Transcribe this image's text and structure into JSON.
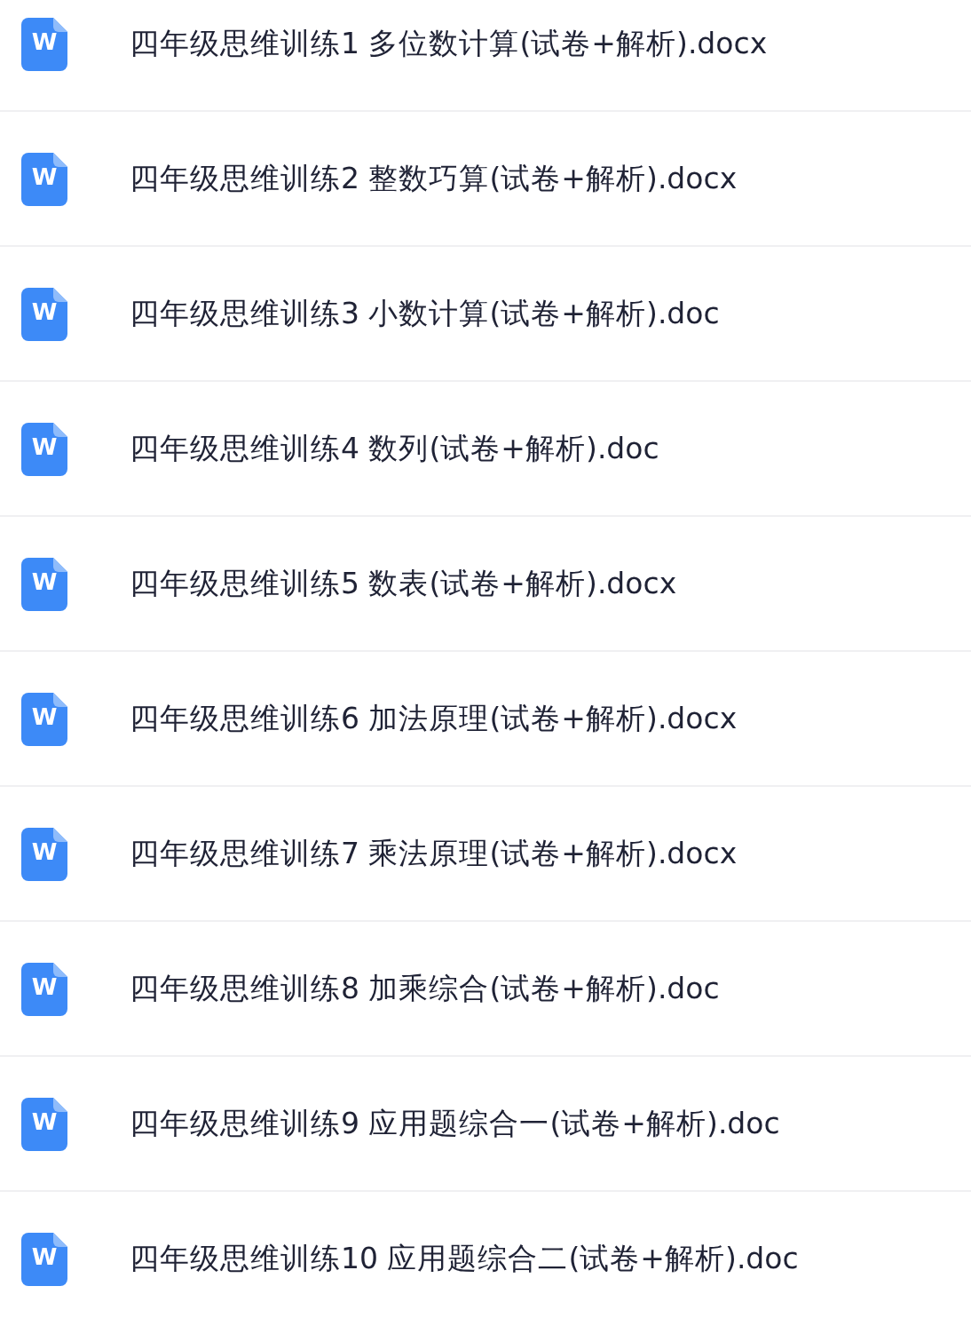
{
  "files": [
    {
      "icon_letter": "W",
      "name": "四年级思维训练1 多位数计算(试卷+解析).docx"
    },
    {
      "icon_letter": "W",
      "name": "四年级思维训练2 整数巧算(试卷+解析).docx"
    },
    {
      "icon_letter": "W",
      "name": "四年级思维训练3 小数计算(试卷+解析).doc"
    },
    {
      "icon_letter": "W",
      "name": "四年级思维训练4 数列(试卷+解析).doc"
    },
    {
      "icon_letter": "W",
      "name": "四年级思维训练5 数表(试卷+解析).docx"
    },
    {
      "icon_letter": "W",
      "name": "四年级思维训练6 加法原理(试卷+解析).docx"
    },
    {
      "icon_letter": "W",
      "name": "四年级思维训练7 乘法原理(试卷+解析).docx"
    },
    {
      "icon_letter": "W",
      "name": "四年级思维训练8 加乘综合(试卷+解析).doc"
    },
    {
      "icon_letter": "W",
      "name": "四年级思维训练9 应用题综合一(试卷+解析).doc"
    },
    {
      "icon_letter": "W",
      "name": "四年级思维训练10 应用题综合二(试卷+解析).doc"
    }
  ]
}
